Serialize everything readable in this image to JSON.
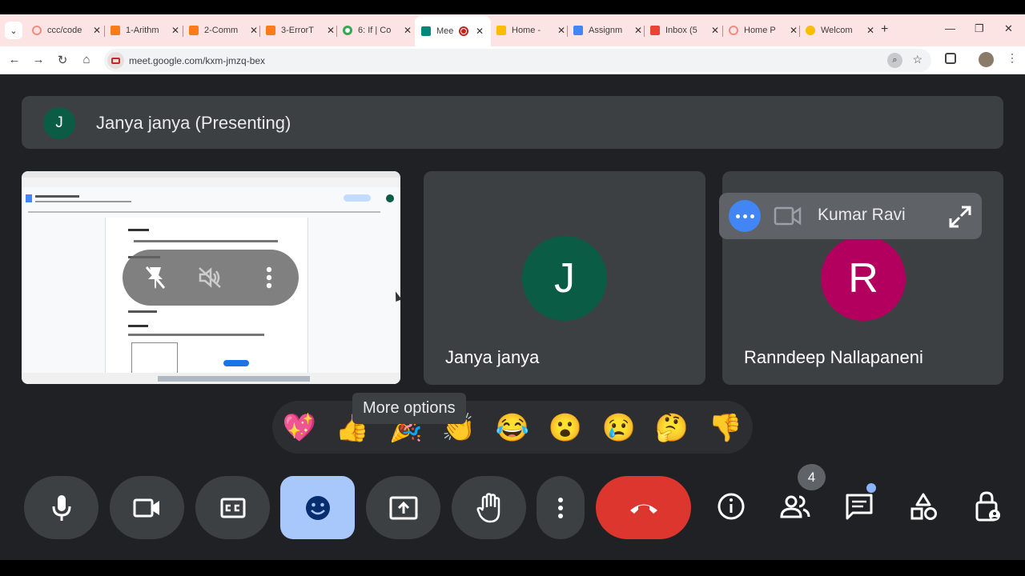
{
  "browser": {
    "tabs": [
      {
        "label": "ccc/code",
        "color": "#f28b82"
      },
      {
        "label": "1-Arithm",
        "color": "#fa7b17"
      },
      {
        "label": "2-Comm",
        "color": "#fa7b17"
      },
      {
        "label": "3-ErrorT",
        "color": "#fa7b17"
      },
      {
        "label": "6: If | Co",
        "color": "#34a853"
      },
      {
        "label": "Mee",
        "color": "#00897b",
        "active": true
      },
      {
        "label": "Home -",
        "color": "#fbbc04"
      },
      {
        "label": "Assignm",
        "color": "#4285f4"
      },
      {
        "label": "Inbox (5",
        "color": "#ea4335"
      },
      {
        "label": "Home P",
        "color": "#f28b82"
      },
      {
        "label": "Welcom",
        "color": "#fbbc04"
      }
    ],
    "url": "meet.google.com/kxm-jmzq-bex"
  },
  "meet": {
    "presenter_initial": "J",
    "presenter_label": "Janya janya (Presenting)",
    "participants": [
      {
        "initial": "J",
        "name": "Janya janya",
        "color": "#0b5c44"
      },
      {
        "initial": "R",
        "name": "Ranndeep Nallapaneni",
        "color": "#b3005e"
      }
    ],
    "hover_participant": "Kumar Ravi",
    "tooltip": "More options",
    "reactions": [
      "💖",
      "👍",
      "🎉",
      "👏",
      "😂",
      "😮",
      "😢",
      "🤔",
      "👎"
    ],
    "people_count": "4"
  }
}
